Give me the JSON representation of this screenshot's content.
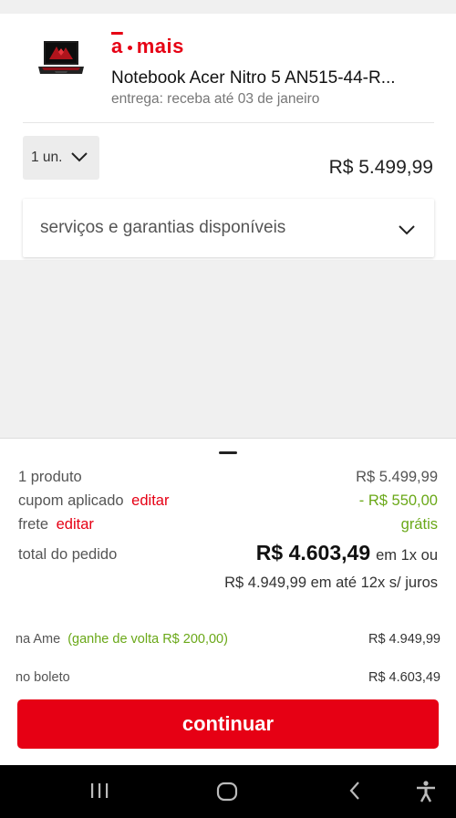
{
  "product": {
    "brand": "a·mais",
    "brand_a": "a",
    "brand_rest": "mais",
    "name": "Notebook Acer Nitro 5 AN515-44-R...",
    "delivery": "entrega: receba até 03 de janeiro",
    "quantity": "1 un.",
    "price": "R$ 5.499,99",
    "services_label": "serviços e garantias disponíveis"
  },
  "summary": {
    "products_label": "1 produto",
    "products_value": "R$ 5.499,99",
    "coupon_label": "cupom aplicado",
    "coupon_edit": "editar",
    "coupon_value": "- R$ 550,00",
    "shipping_label": "frete",
    "shipping_edit": "editar",
    "shipping_value": "grátis",
    "total_label": "total do pedido",
    "total_value": "R$ 4.603,49",
    "total_suffix": "em 1x ou",
    "installments": "R$ 4.949,99 em até 12x s/ juros"
  },
  "payment": {
    "ame_label": "na Ame",
    "ame_cashback": "(ganhe de volta R$ 200,00)",
    "ame_value": "R$ 4.949,99",
    "boleto_label": "no boleto",
    "boleto_value": "R$ 4.603,49"
  },
  "actions": {
    "continue_label": "continuar"
  },
  "colors": {
    "brand_red": "#e60014",
    "green": "#6aa818",
    "nav_bg": "#000000"
  },
  "icons": {
    "qty_chevron": "chevron-down-icon",
    "services_chevron": "chevron-down-icon",
    "nav_recents": "recents-icon",
    "nav_home": "home-icon",
    "nav_back": "back-icon",
    "nav_accessibility": "accessibility-icon"
  }
}
